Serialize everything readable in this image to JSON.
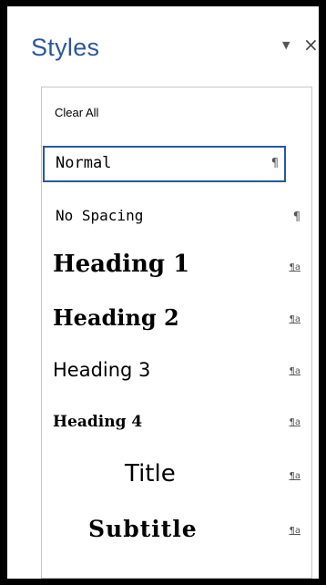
{
  "pane": {
    "title": "Styles",
    "dropdown_glyph": "▼",
    "close_glyph": "×"
  },
  "styles": {
    "clear_all": "Clear All",
    "items": [
      {
        "label": "Normal",
        "mark": "¶",
        "selected": true
      },
      {
        "label": "No Spacing",
        "mark": "¶"
      },
      {
        "label": "Heading 1",
        "mark": "¶a"
      },
      {
        "label": "Heading 2",
        "mark": "¶a"
      },
      {
        "label": "Heading 3",
        "mark": "¶a"
      },
      {
        "label": "Heading 4",
        "mark": "¶a"
      },
      {
        "label": "Title",
        "mark": "¶a"
      },
      {
        "label": "Subtitle",
        "mark": "¶a"
      }
    ]
  },
  "colors": {
    "title": "#2b579a",
    "selection_border": "#2b579a",
    "frame": "#000000"
  }
}
